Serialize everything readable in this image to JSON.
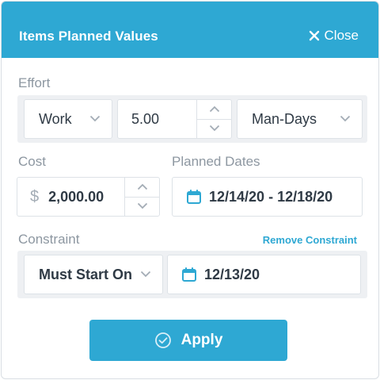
{
  "header": {
    "title": "Items Planned Values",
    "close_label": "Close"
  },
  "effort": {
    "label": "Effort",
    "type_value": "Work",
    "amount_value": "5.00",
    "unit_value": "Man-Days"
  },
  "cost": {
    "label": "Cost",
    "currency_symbol": "$",
    "amount_value": "2,000.00"
  },
  "planned_dates": {
    "label": "Planned Dates",
    "range_value": "12/14/20 - 12/18/20"
  },
  "constraint": {
    "label": "Constraint",
    "remove_link": "Remove Constraint",
    "type_value": "Must Start On",
    "date_value": "12/13/20"
  },
  "footer": {
    "apply_label": "Apply"
  },
  "colors": {
    "accent": "#2ea8d3",
    "label_gray": "#8d97a1",
    "group_bg": "#eef0f3"
  },
  "icons": [
    "close-icon",
    "chevron-down-icon",
    "chevron-up-icon",
    "calendar-icon",
    "check-circle-icon"
  ]
}
